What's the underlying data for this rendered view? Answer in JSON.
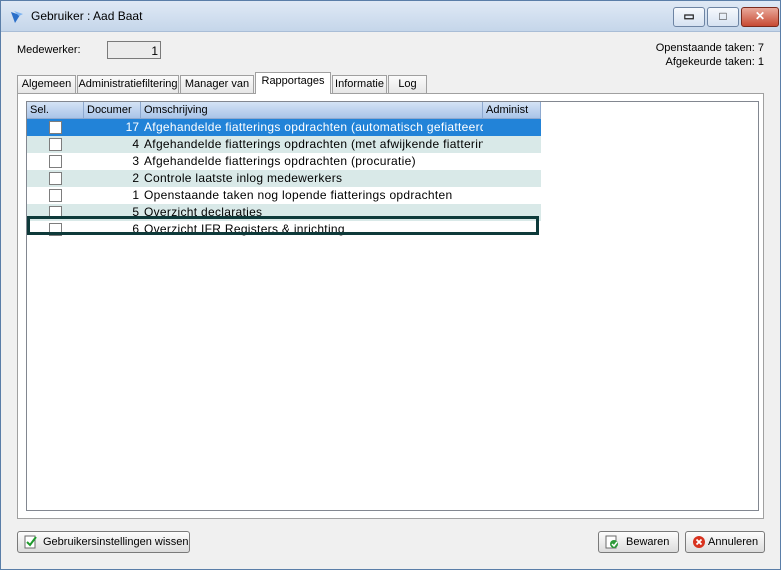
{
  "window": {
    "title": "Gebruiker : Aad Baat"
  },
  "controls": {
    "minimize": "▭",
    "maximize": "□",
    "close": "✕"
  },
  "header": {
    "medewerker_label": "Medewerker:",
    "medewerker_value": "1",
    "openstaande": "Openstaande taken: 7",
    "afgekeurde": "Afgekeurde taken: 1"
  },
  "tabs": [
    "Algemeen",
    "Administratiefiltering",
    "Manager van",
    "Rapportages",
    "Informatie",
    "Log"
  ],
  "active_tab": "Rapportages",
  "grid": {
    "columns": [
      "Sel.",
      "Documer",
      "Omschrijving",
      "Administ"
    ],
    "rows": [
      {
        "doc": "17",
        "desc": "Afgehandelde fiatterings opdrachten (automatisch gefiatteerd)",
        "checked": false,
        "selected": true
      },
      {
        "doc": "4",
        "desc": "Afgehandelde fiatterings opdrachten (met afwijkende fiattering)",
        "checked": false
      },
      {
        "doc": "3",
        "desc": "Afgehandelde fiatterings opdrachten (procuratie)",
        "checked": false
      },
      {
        "doc": "2",
        "desc": "Controle laatste inlog medewerkers",
        "checked": false
      },
      {
        "doc": "1",
        "desc": "Openstaande taken nog lopende fiatterings opdrachten",
        "checked": false
      },
      {
        "doc": "5",
        "desc": "Overzicht declaraties",
        "checked": false
      },
      {
        "doc": "6",
        "desc": "Overzicht IFR Registers & inrichting",
        "checked": false,
        "focused": true
      }
    ]
  },
  "buttons": {
    "reset": "Gebruikersinstellingen wissen",
    "save": "Bewaren",
    "cancel": "Annuleren"
  }
}
